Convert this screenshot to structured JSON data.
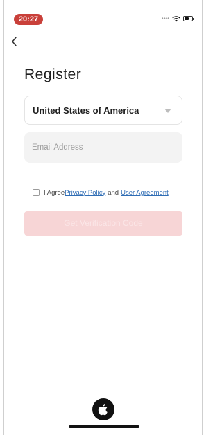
{
  "status_bar": {
    "time": "20:27"
  },
  "header": {
    "title": "Register"
  },
  "form": {
    "country": "United States of America",
    "email_placeholder": "Email Address",
    "email_value": ""
  },
  "agreement": {
    "prefix": "I Agree",
    "privacy_policy": "Privacy Policy",
    "conjunction": "and",
    "user_agreement": "User Agreement",
    "checked": false
  },
  "actions": {
    "get_code_label": "Get Verification Code"
  },
  "icons": {
    "back": "chevron-left-icon",
    "apple": "apple-icon",
    "wifi": "wifi-icon",
    "battery": "battery-icon"
  },
  "colors": {
    "time_pill": "#c9403a",
    "button_disabled_bg": "#f7d5d6",
    "link": "#2f6db5"
  }
}
